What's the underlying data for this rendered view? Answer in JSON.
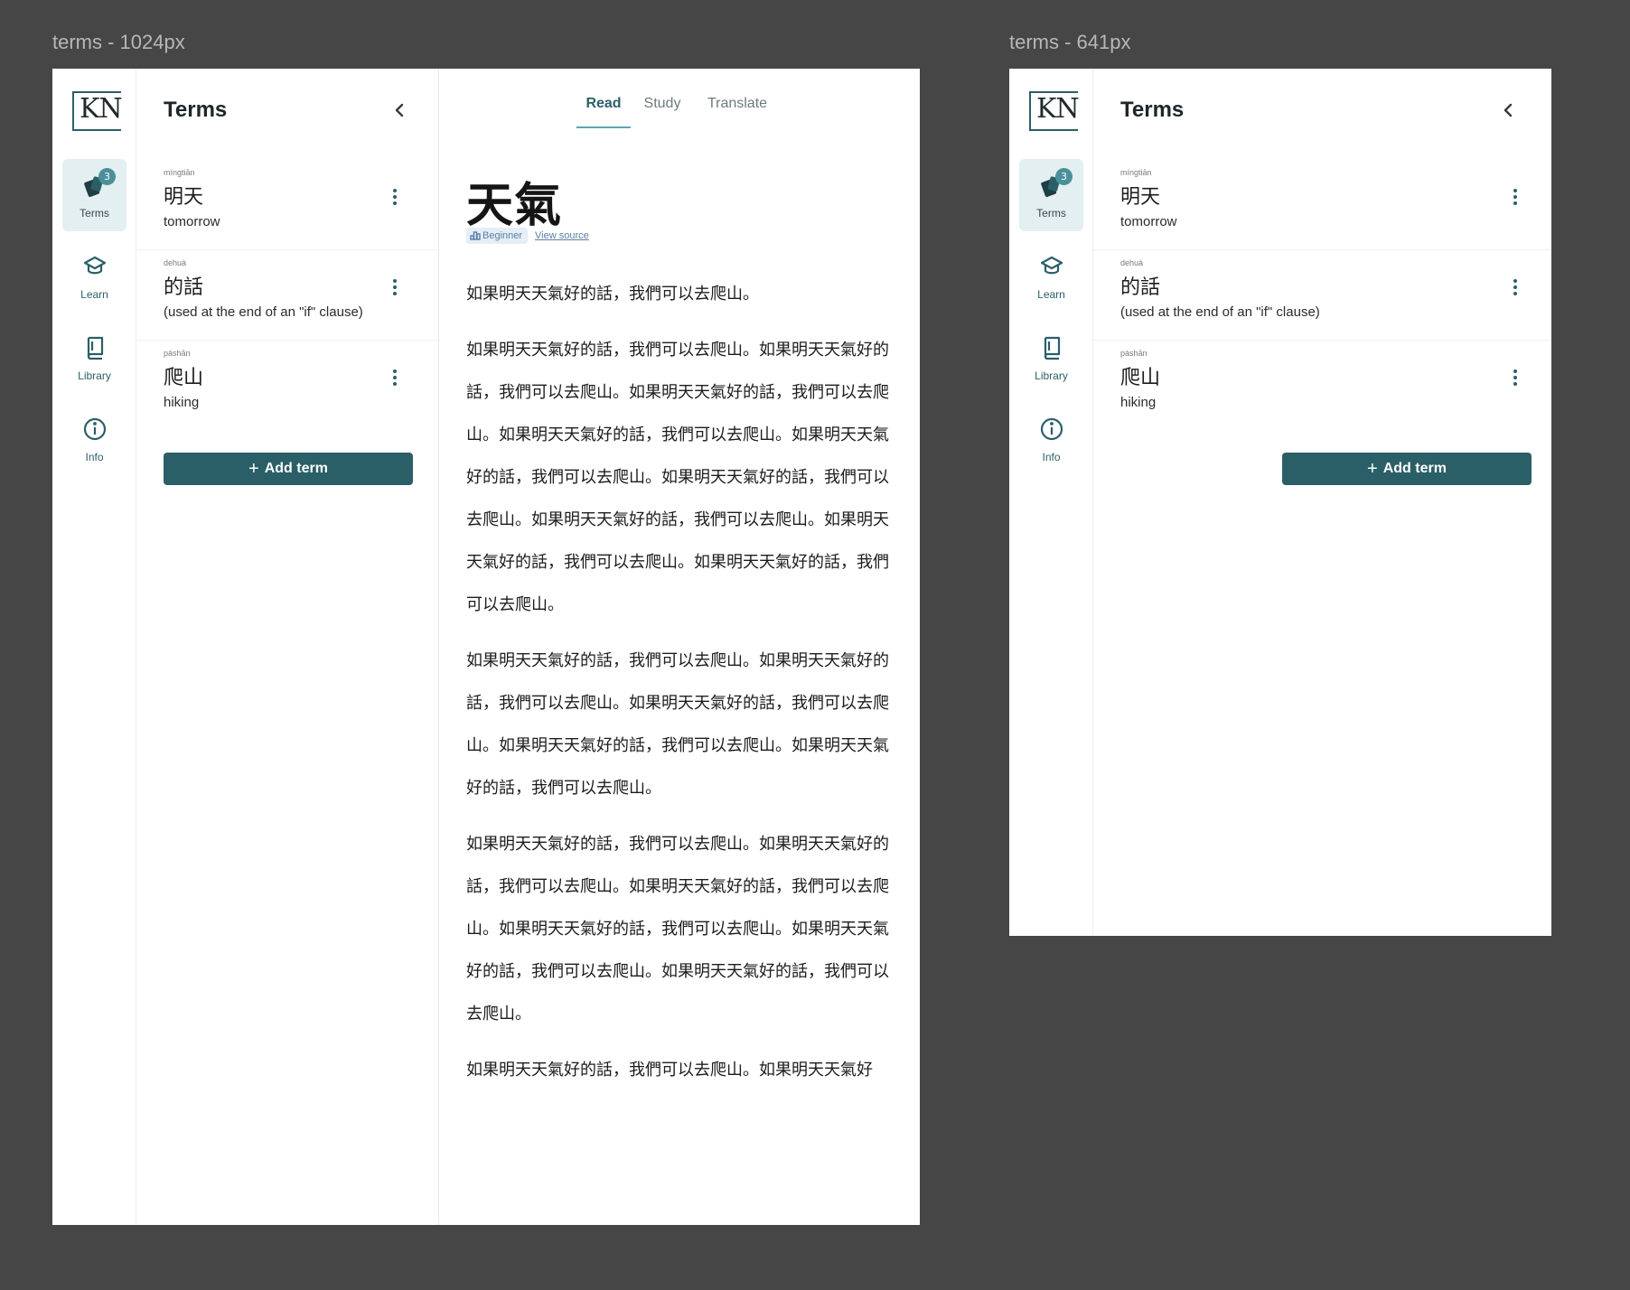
{
  "frames": [
    {
      "label": "terms - 1024px",
      "logo": "KN",
      "nav": [
        {
          "label": "Terms",
          "icon": "cards-icon",
          "badge": "3",
          "active": true
        },
        {
          "label": "Learn",
          "icon": "graduation-cap-icon"
        },
        {
          "label": "Library",
          "icon": "book-icon"
        },
        {
          "label": "Info",
          "icon": "info-icon"
        }
      ],
      "panel_title": "Terms",
      "terms": [
        {
          "pinyin": "míngtiān",
          "hanzi": "明天",
          "meaning": "tomorrow"
        },
        {
          "pinyin": "dehuà",
          "hanzi": "的話",
          "meaning": "(used at the end of an \"if\" clause)"
        },
        {
          "pinyin": "páshān",
          "hanzi": "爬山",
          "meaning": "hiking"
        }
      ],
      "add_button": "Add term",
      "reader": {
        "tabs": [
          "Read",
          "Study",
          "Translate"
        ],
        "active_tab": "Read",
        "title": "天氣",
        "level": "Beginner",
        "source_link": "View source",
        "paragraphs": [
          "如果明天天氣好的話，我們可以去爬山。",
          "如果明天天氣好的話，我們可以去爬山。如果明天天氣好的話，我們可以去爬山。如果明天天氣好的話，我們可以去爬山。如果明天天氣好的話，我們可以去爬山。如果明天天氣好的話，我們可以去爬山。如果明天天氣好的話，我們可以去爬山。如果明天天氣好的話，我們可以去爬山。如果明天天氣好的話，我們可以去爬山。如果明天天氣好的話，我們可以去爬山。",
          "如果明天天氣好的話，我們可以去爬山。如果明天天氣好的話，我們可以去爬山。如果明天天氣好的話，我們可以去爬山。如果明天天氣好的話，我們可以去爬山。如果明天天氣好的話，我們可以去爬山。",
          "如果明天天氣好的話，我們可以去爬山。如果明天天氣好的話，我們可以去爬山。如果明天天氣好的話，我們可以去爬山。如果明天天氣好的話，我們可以去爬山。如果明天天氣好的話，我們可以去爬山。如果明天天氣好的話，我們可以去爬山。",
          "如果明天天氣好的話，我們可以去爬山。如果明天天氣好"
        ]
      }
    },
    {
      "label": "terms - 641px",
      "logo": "KN",
      "nav": [
        {
          "label": "Terms",
          "icon": "cards-icon",
          "badge": "3",
          "active": true
        },
        {
          "label": "Learn",
          "icon": "graduation-cap-icon"
        },
        {
          "label": "Library",
          "icon": "book-icon"
        },
        {
          "label": "Info",
          "icon": "info-icon"
        }
      ],
      "panel_title": "Terms",
      "terms": [
        {
          "pinyin": "míngtiān",
          "hanzi": "明天",
          "meaning": "tomorrow"
        },
        {
          "pinyin": "dehuà",
          "hanzi": "的話",
          "meaning": "(used at the end of an \"if\" clause)"
        },
        {
          "pinyin": "páshān",
          "hanzi": "爬山",
          "meaning": "hiking"
        }
      ],
      "add_button": "Add term"
    }
  ],
  "colors": {
    "canvas": "#464646",
    "accent": "#2b5f68",
    "active_nav_bg": "#e3eff1",
    "tab_underline": "#5ea6ae",
    "badge": "#4b8f99",
    "level_badge_bg": "#e5eef6",
    "link": "#5a7ea3"
  }
}
